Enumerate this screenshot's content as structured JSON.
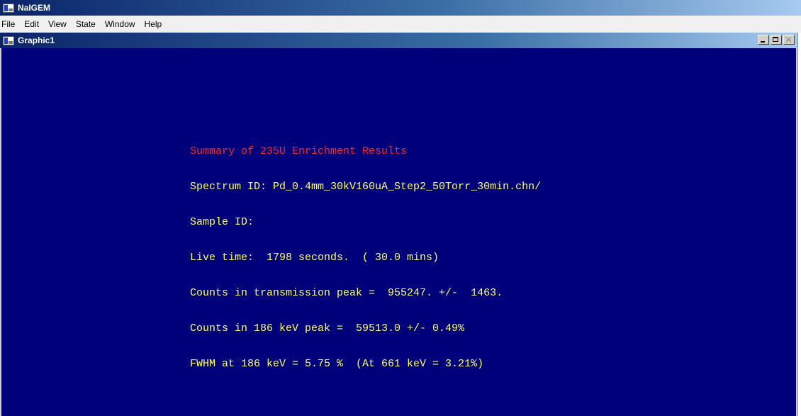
{
  "app": {
    "title": "NaIGEM",
    "icon": "app-window-icon"
  },
  "menu": {
    "items": [
      "File",
      "Edit",
      "View",
      "State",
      "Window",
      "Help"
    ]
  },
  "child_window": {
    "title": "Graphic1",
    "icon": "graphic-window-icon",
    "buttons": [
      "minimize",
      "maximize",
      "close"
    ]
  },
  "colors": {
    "background": "#00007a",
    "heading": "#ff2020",
    "text": "#ffff66",
    "titlebar_start": "#0a246a",
    "titlebar_end": "#a6caf0"
  },
  "report": {
    "heading": "Summary of 235U Enrichment Results",
    "spectrum_id": "Spectrum ID: Pd_0.4mm_30kV160uA_Step2_50Torr_30min.chn/",
    "sample_id": "Sample ID:",
    "live_time": "Live time:  1798 seconds.  ( 30.0 mins)",
    "transmission_peak": "Counts in transmission peak =  955247. +/-  1463.",
    "peak_186": "Counts in 186 keV peak =  59513.0 +/- 0.49%",
    "fwhm": "FWHM at 186 keV = 5.75 %  (At 661 keV = 3.21%)"
  }
}
